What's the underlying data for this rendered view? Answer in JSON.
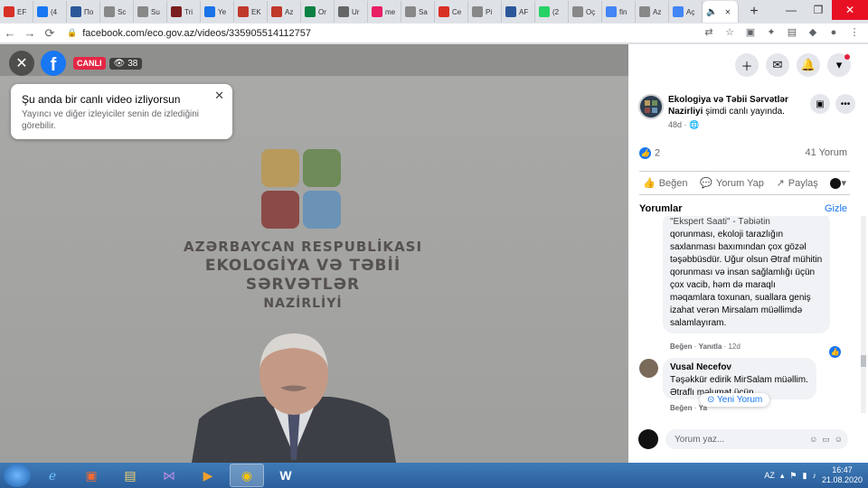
{
  "browser": {
    "tabs": [
      {
        "label": "EF",
        "color": "#d93025"
      },
      {
        "label": "(4",
        "color": "#1877f2"
      },
      {
        "label": "По",
        "color": "#2b579a"
      },
      {
        "label": "Sc",
        "color": "#888888"
      },
      {
        "label": "Su",
        "color": "#888888"
      },
      {
        "label": "Tri",
        "color": "#7b1e1e"
      },
      {
        "label": "Ye",
        "color": "#1a73e8"
      },
      {
        "label": "EK",
        "color": "#c0392b"
      },
      {
        "label": "Az",
        "color": "#c0392b"
      },
      {
        "label": "Or",
        "color": "#0b8043"
      },
      {
        "label": "Ur",
        "color": "#666666"
      },
      {
        "label": "me",
        "color": "#e91e63"
      },
      {
        "label": "Sa",
        "color": "#888888"
      },
      {
        "label": "Ce",
        "color": "#d93025"
      },
      {
        "label": "Pi",
        "color": "#888888"
      },
      {
        "label": "AF",
        "color": "#2b579a"
      },
      {
        "label": "(2",
        "color": "#25d366"
      },
      {
        "label": "Oç",
        "color": "#888888"
      },
      {
        "label": "fin",
        "color": "#4285f4"
      },
      {
        "label": "Az",
        "color": "#888888"
      },
      {
        "label": "Aç",
        "color": "#4285f4"
      }
    ],
    "url": "facebook.com/eco.gov.az/videos/335905514112757"
  },
  "video": {
    "live_label": "CANLI",
    "viewer_count": "38",
    "toast_title": "Şu anda bir canlı video izliyorsun",
    "toast_text": "Yayıncı ve diğer izleyiciler senin de izlediğini görebilir.",
    "ministry_line1": "AZƏRBAYCAN RESPUBLİKASI",
    "ministry_line2": "EKOLOGİYA VƏ TƏBİİ SƏRVƏTLƏR",
    "ministry_line3": "NAZİRLİYİ"
  },
  "sidebar": {
    "page_name": "Ekologiya və Təbii Sərvətlər Nazirliyi",
    "page_suffix": " şimdi canlı yayında.",
    "page_time": "48d",
    "likes": "2",
    "comments_count": "41 Yorum",
    "action_like": "Beğen",
    "action_comment": "Yorum Yap",
    "action_share": "Paylaş",
    "comments_title": "Yorumlar",
    "hide_label": "Gizle",
    "comment1_cut": "\"Ekspert Saati\" - Təbiətin",
    "comment1": "qorunması, ekoloji tarazlığın saxlanması baxımından çox gözəl təşəbbüsdür. Uğur olsun Ətraf mühitin qorunması və insan sağlamlığı üçün çox vacib, həm də maraqlı məqamlara toxunan, suallara geniş izahat verən Mirsalam müəllimdə salamlayıram.",
    "comment1_meta_like": "Beğen",
    "comment1_meta_reply": "Yanıtla",
    "comment1_meta_time": "12d",
    "comment2_author": "Vusal Necefov",
    "comment2": "Təşəkkür edirik MirSalam müəllim. Ətraflı məlumat üçün",
    "comment2_meta_like": "Beğen",
    "comment2_meta_reply": "Ya",
    "new_comment": "Yeni Yorum",
    "composer_placeholder": "Yorum yaz..."
  },
  "taskbar": {
    "lang": "AZ",
    "time": "16:47",
    "date": "21.08.2020"
  }
}
